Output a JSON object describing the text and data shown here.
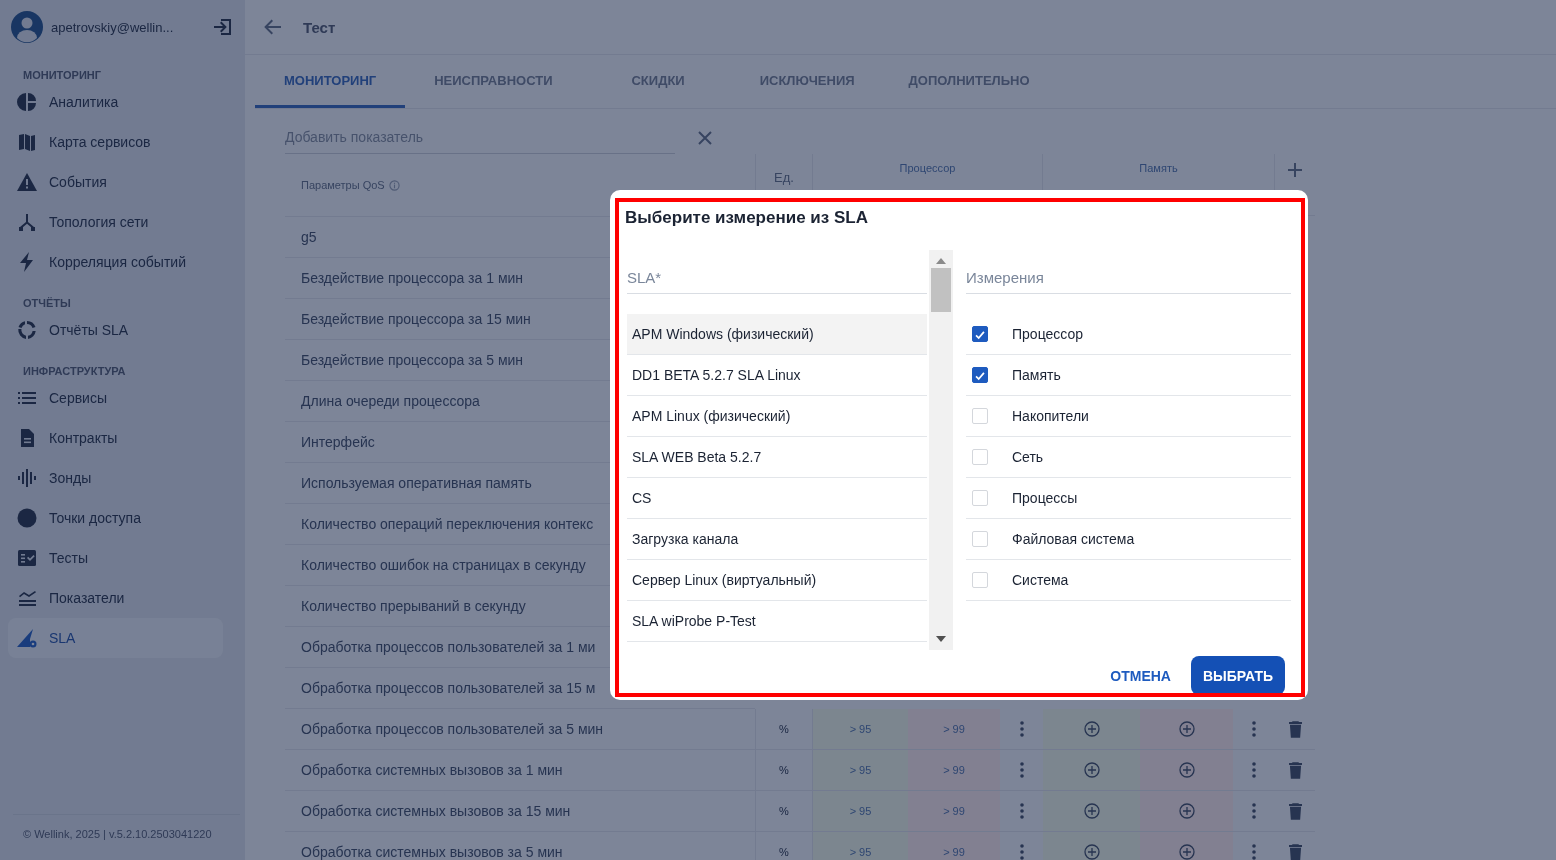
{
  "user": {
    "email": "apetrovskiy@wellin..."
  },
  "sidebar": {
    "sections": [
      {
        "title": "МОНИТОРИНГ",
        "items": [
          {
            "label": "Аналитика",
            "selected": false
          },
          {
            "label": "Карта сервисов",
            "selected": false
          },
          {
            "label": "События",
            "selected": false
          },
          {
            "label": "Топология сети",
            "selected": false
          },
          {
            "label": "Корреляция событий",
            "selected": false
          }
        ]
      },
      {
        "title": "ОТЧЁТЫ",
        "items": [
          {
            "label": "Отчёты SLA",
            "selected": false
          }
        ]
      },
      {
        "title": "ИНФРАСТРУКТУРА",
        "items": [
          {
            "label": "Сервисы",
            "selected": false
          },
          {
            "label": "Контракты",
            "selected": false
          },
          {
            "label": "Зонды",
            "selected": false
          },
          {
            "label": "Точки доступа",
            "selected": false
          },
          {
            "label": "Тесты",
            "selected": false
          },
          {
            "label": "Показатели",
            "selected": false
          },
          {
            "label": "SLA",
            "selected": true
          }
        ]
      }
    ]
  },
  "footer": "© Wellink, 2025 | v.5.2.10.2503041220",
  "header": {
    "title": "Тест"
  },
  "tabs": [
    {
      "label": "МОНИТОРИНГ",
      "selected": true
    },
    {
      "label": "НЕИСПРАВНОСТИ",
      "selected": false
    },
    {
      "label": "СКИДКИ",
      "selected": false
    },
    {
      "label": "ИСКЛЮЧЕНИЯ",
      "selected": false
    },
    {
      "label": "ДОПОЛНИТЕЛЬНО",
      "selected": false
    }
  ],
  "add_field": {
    "placeholder": "Добавить показатель"
  },
  "table": {
    "columns": {
      "name": "Параметры QoS",
      "unit": "Ед.",
      "groups": [
        "Процессор",
        "Память"
      ]
    },
    "rows": [
      {
        "name": "g5"
      },
      {
        "name": "Бездействие процессора за 1 мин"
      },
      {
        "name": "Бездействие процессора за 15 мин"
      },
      {
        "name": "Бездействие процессора за 5 мин"
      },
      {
        "name": "Длина очереди процессора"
      },
      {
        "name": "Интерфейс"
      },
      {
        "name": "Используемая оперативная память"
      },
      {
        "name": "Количество операций переключения контекс"
      },
      {
        "name": "Количество ошибок на страницах в секунду"
      },
      {
        "name": "Количество прерываний в секунду"
      },
      {
        "name": "Обработка процессов пользователей за 1 ми"
      },
      {
        "name": "Обработка процессов пользователей за 15 м"
      },
      {
        "name": "Обработка процессов пользователей за 5 мин",
        "unit": "%",
        "values": [
          "> 95",
          "> 99"
        ]
      },
      {
        "name": "Обработка системных вызовов за 1 мин",
        "unit": "%",
        "values": [
          "> 95",
          "> 99"
        ]
      },
      {
        "name": "Обработка системных вызовов за 15 мин",
        "unit": "%",
        "values": [
          "> 95",
          "> 99"
        ]
      },
      {
        "name": "Обработка системных вызовов за 5 мин",
        "unit": "%",
        "values": [
          "> 95",
          "> 99"
        ]
      }
    ]
  },
  "dialog": {
    "title": "Выберите измерение из SLA",
    "sla_field": {
      "label": "SLA*"
    },
    "sla_options": [
      {
        "label": "APM Windows (физический)",
        "selected": true
      },
      {
        "label": "DD1 BETA 5.2.7 SLA Linux",
        "selected": false
      },
      {
        "label": "APM Linux (физический)",
        "selected": false
      },
      {
        "label": "SLA WEB Beta 5.2.7",
        "selected": false
      },
      {
        "label": "CS",
        "selected": false
      },
      {
        "label": "Загрузка канала",
        "selected": false
      },
      {
        "label": "Сервер Linux (виртуальный)",
        "selected": false
      },
      {
        "label": "SLA wiProbe P-Test",
        "selected": false
      }
    ],
    "measure_field": {
      "label": "Измерения"
    },
    "measures": [
      {
        "label": "Процессор",
        "checked": true
      },
      {
        "label": "Память",
        "checked": true
      },
      {
        "label": "Накопители",
        "checked": false
      },
      {
        "label": "Сеть",
        "checked": false
      },
      {
        "label": "Процессы",
        "checked": false
      },
      {
        "label": "Файловая система",
        "checked": false
      },
      {
        "label": "Система",
        "checked": false
      }
    ],
    "buttons": {
      "cancel": "ОТМЕНА",
      "confirm": "ВЫБРАТЬ"
    }
  }
}
